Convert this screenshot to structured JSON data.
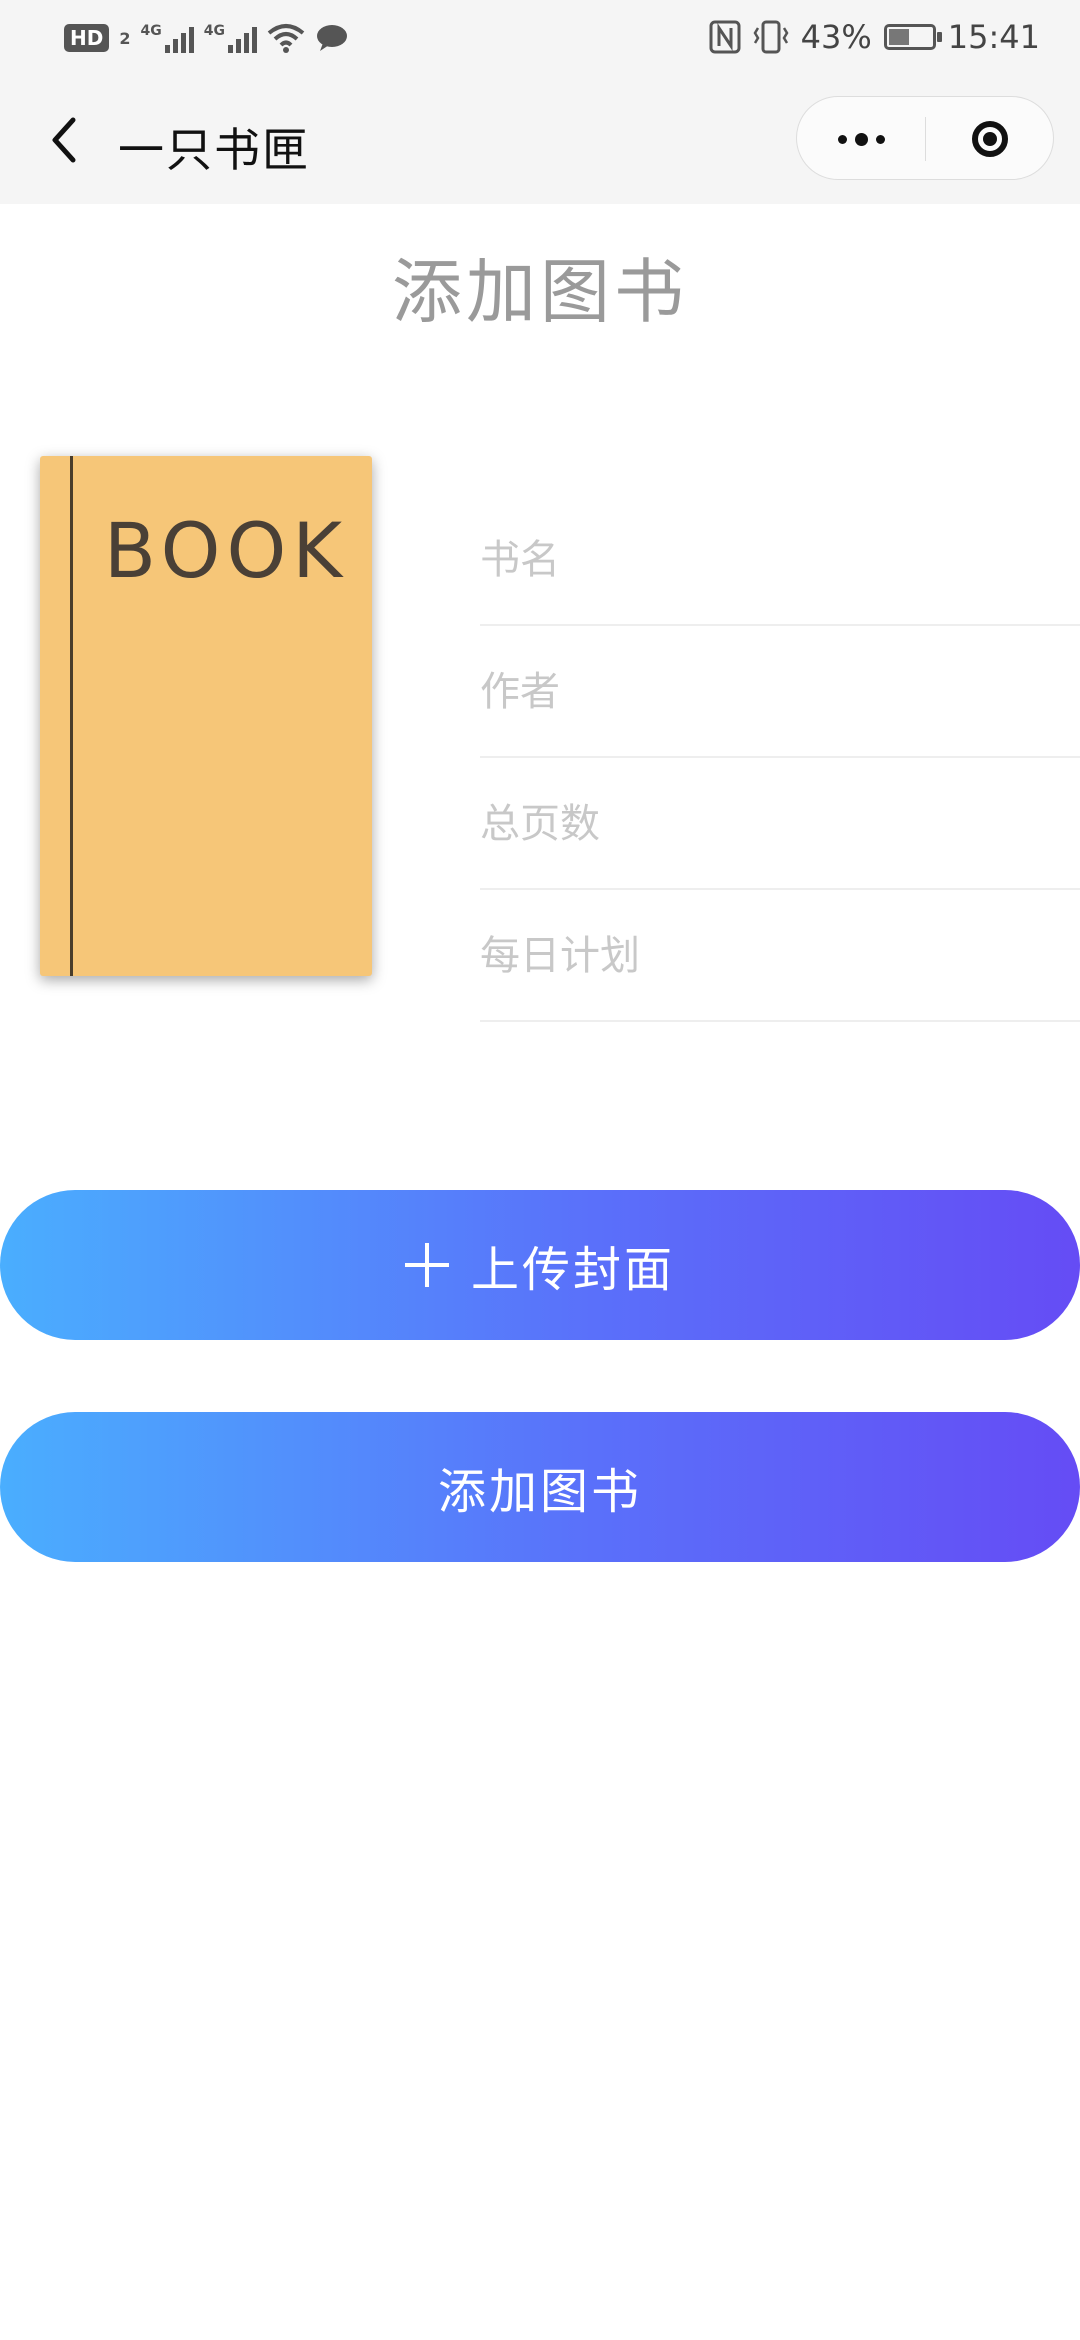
{
  "status_bar": {
    "hd": "HD",
    "hd_sub": "2",
    "net1": "4G",
    "net2": "4G",
    "battery_percent": "43%",
    "battery_level": 0.43,
    "time": "15:41",
    "icons": [
      "signal-icon",
      "wifi-icon",
      "chat-icon",
      "nfc-icon",
      "vibrate-icon",
      "battery-icon"
    ]
  },
  "nav": {
    "title": "一只书匣",
    "icons": [
      "back-arrow-icon",
      "more-dots-icon",
      "close-circle-icon"
    ]
  },
  "page": {
    "title": "添加图书"
  },
  "cover": {
    "text": "BOOK",
    "color": "#f6c678"
  },
  "form": {
    "fields": [
      {
        "placeholder": "书名",
        "value": ""
      },
      {
        "placeholder": "作者",
        "value": ""
      },
      {
        "placeholder": "总页数",
        "value": ""
      },
      {
        "placeholder": "每日计划",
        "value": ""
      }
    ]
  },
  "buttons": {
    "upload_label": "上传封面",
    "add_label": "添加图书",
    "gradient": [
      "#4aaefe",
      "#654cf5"
    ]
  }
}
